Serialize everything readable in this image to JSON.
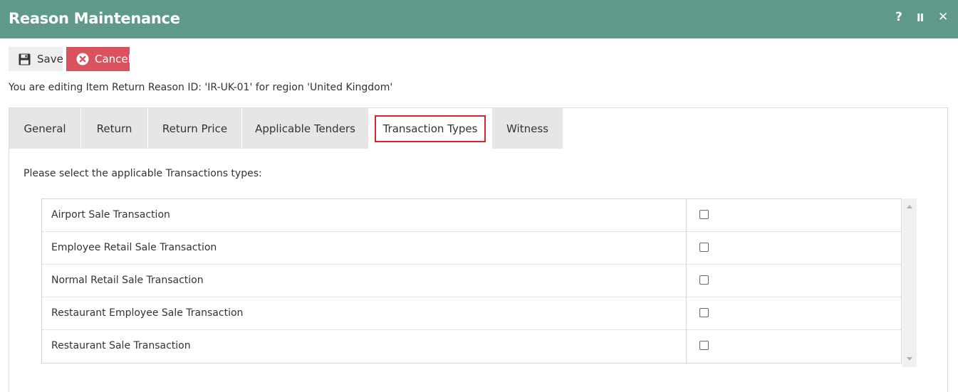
{
  "window": {
    "title": "Reason Maintenance",
    "help_label": "?",
    "pause_label": "II",
    "close_label": "✕"
  },
  "toolbar": {
    "save_label": "Save",
    "cancel_label": "Cancel"
  },
  "context": {
    "editing_text": "You are editing Item Return Reason ID: 'IR-UK-01' for region 'United Kingdom'"
  },
  "tabs": [
    {
      "label": "General"
    },
    {
      "label": "Return"
    },
    {
      "label": "Return Price"
    },
    {
      "label": "Applicable Tenders"
    },
    {
      "label": "Transaction Types"
    },
    {
      "label": "Witness"
    }
  ],
  "active_tab": "Transaction Types",
  "transaction_types": {
    "instruction": "Please select the applicable Transactions types:",
    "rows": [
      {
        "name": "Airport Sale Transaction",
        "checked": false
      },
      {
        "name": "Employee Retail Sale Transaction",
        "checked": false
      },
      {
        "name": "Normal Retail Sale Transaction",
        "checked": false
      },
      {
        "name": "Restaurant Employee Sale Transaction",
        "checked": false
      },
      {
        "name": "Restaurant Sale Transaction",
        "checked": false
      }
    ]
  },
  "colors": {
    "titlebar": "#5f998a",
    "cancel": "#d9535f",
    "active_tab_outline": "#d9232e"
  },
  "icons": {
    "save": "floppy-disk-icon",
    "cancel": "x-circle-icon"
  }
}
